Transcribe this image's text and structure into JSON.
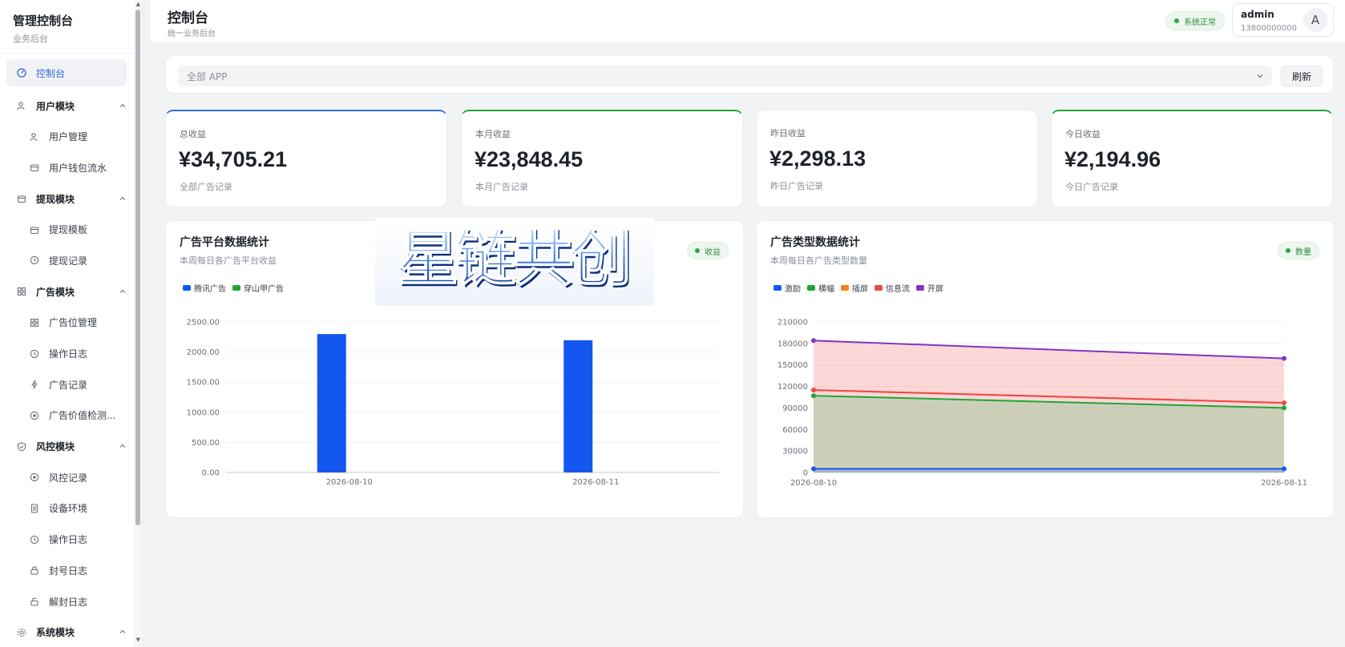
{
  "sidebar": {
    "title": "管理控制台",
    "subtitle": "业务后台",
    "items": [
      {
        "label": "控制台",
        "icon": "dashboard-icon",
        "level": "top",
        "active": true
      },
      {
        "label": "用户模块",
        "icon": "users-icon",
        "level": "top",
        "expanded": true
      },
      {
        "label": "用户管理",
        "icon": "users-icon",
        "level": "sub"
      },
      {
        "label": "用户钱包流水",
        "icon": "wallet-icon",
        "level": "sub"
      },
      {
        "label": "提现模块",
        "icon": "wallet-icon",
        "level": "top",
        "expanded": true
      },
      {
        "label": "提现模板",
        "icon": "wallet-icon",
        "level": "sub"
      },
      {
        "label": "提现记录",
        "icon": "clock-icon",
        "level": "sub"
      },
      {
        "label": "广告模块",
        "icon": "grid-icon",
        "level": "top",
        "expanded": true
      },
      {
        "label": "广告位管理",
        "icon": "grid-icon",
        "level": "sub"
      },
      {
        "label": "操作日志",
        "icon": "clock-icon",
        "level": "sub"
      },
      {
        "label": "广告记录",
        "icon": "bolt-icon",
        "level": "sub"
      },
      {
        "label": "广告价值检测...",
        "icon": "target-icon",
        "level": "sub"
      },
      {
        "label": "风控模块",
        "icon": "shield-icon",
        "level": "top",
        "expanded": true
      },
      {
        "label": "风控记录",
        "icon": "target-icon",
        "level": "sub"
      },
      {
        "label": "设备环境",
        "icon": "device-icon",
        "level": "sub"
      },
      {
        "label": "操作日志",
        "icon": "clock-icon",
        "level": "sub"
      },
      {
        "label": "封号日志",
        "icon": "lock-icon",
        "level": "sub"
      },
      {
        "label": "解封日志",
        "icon": "unlock-icon",
        "level": "sub"
      },
      {
        "label": "系统模块",
        "icon": "gear-icon",
        "level": "top",
        "expanded": true
      }
    ]
  },
  "header": {
    "title": "控制台",
    "subtitle": "统一业务后台",
    "status": "系统正常",
    "user_name": "admin",
    "user_phone": "13800000000",
    "avatar_letter": "A"
  },
  "filter": {
    "app_select_value": "全部 APP",
    "refresh_label": "刷新"
  },
  "stats": [
    {
      "label": "总收益",
      "value": "¥34,705.21",
      "note": "全部广告记录",
      "accent": "#2f6bd6"
    },
    {
      "label": "本月收益",
      "value": "¥23,848.45",
      "note": "本月广告记录",
      "accent": "#1fa637"
    },
    {
      "label": "昨日收益",
      "value": "¥2,298.13",
      "note": "昨日广告记录",
      "accent": null
    },
    {
      "label": "今日收益",
      "value": "¥2,194.96",
      "note": "今日广告记录",
      "accent": "#1fa637"
    }
  ],
  "logo_text": "星链共创",
  "platform_panel": {
    "title": "广告平台数据统计",
    "subtitle": "本周每日各广告平台收益",
    "badge": "收益"
  },
  "type_panel": {
    "title": "广告类型数据统计",
    "subtitle": "本周每日各广告类型数量",
    "badge": "数量"
  },
  "chart_data": [
    {
      "type": "bar",
      "title": "广告平台数据统计",
      "categories": [
        "2026-08-10",
        "2026-08-11"
      ],
      "series": [
        {
          "name": "腾讯广告",
          "color": "#1456f0",
          "values": [
            2298.13,
            2194.96
          ]
        },
        {
          "name": "穿山甲广告",
          "color": "#1fa637",
          "values": [
            0,
            0
          ]
        }
      ],
      "ylim": [
        0,
        2500
      ],
      "yticks": [
        "0.00",
        "500.00",
        "1000.00",
        "1500.00",
        "2000.00",
        "2500.00"
      ],
      "legend": "top-left",
      "grid": true
    },
    {
      "type": "area",
      "title": "广告类型数据统计",
      "categories": [
        "2026-08-10",
        "2026-08-11"
      ],
      "series": [
        {
          "name": "激励",
          "color": "#1456f0",
          "values": [
            5000,
            5000
          ]
        },
        {
          "name": "横幅",
          "color": "#1fa637",
          "values": [
            107000,
            90000
          ]
        },
        {
          "name": "插屏",
          "color": "#f5811f",
          "values": [
            115000,
            97000
          ]
        },
        {
          "name": "信息流",
          "color": "#f04848",
          "values": [
            115000,
            97000
          ]
        },
        {
          "name": "开屏",
          "color": "#8234c4",
          "values": [
            184000,
            159000
          ]
        }
      ],
      "ylim": [
        0,
        210000
      ],
      "yticks": [
        "0",
        "30000",
        "60000",
        "90000",
        "120000",
        "150000",
        "180000",
        "210000"
      ],
      "legend": "top-left",
      "grid": true
    }
  ]
}
